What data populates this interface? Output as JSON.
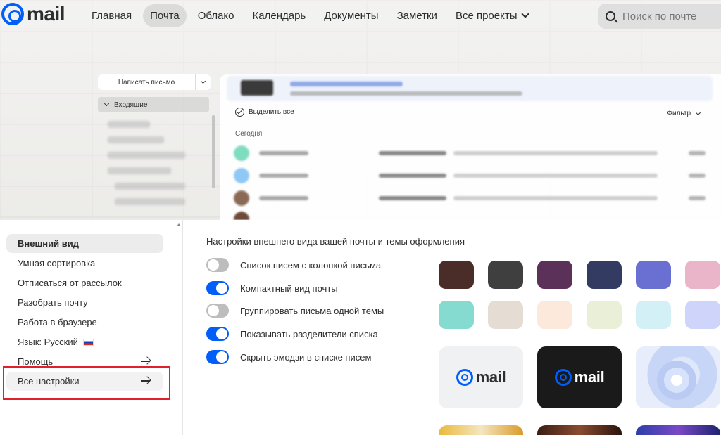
{
  "header": {
    "logo_text": "mail",
    "nav": [
      "Главная",
      "Почта",
      "Облако",
      "Календарь",
      "Документы",
      "Заметки",
      "Все проекты"
    ],
    "active_nav": "Почта",
    "search_placeholder": "Поиск по почте"
  },
  "mail_bg": {
    "compose_label": "Написать письмо",
    "inbox_label": "Входящие",
    "select_all": "Выделить все",
    "filter": "Фильтр",
    "today": "Сегодня"
  },
  "menu": {
    "items": [
      "Внешний вид",
      "Умная сортировка",
      "Отписаться от рассылок",
      "Разобрать почту",
      "Работа в браузере",
      "Язык: Русский",
      "Помощь",
      "Все настройки"
    ]
  },
  "appearance": {
    "title": "Настройки внешнего вида вашей почты и темы оформления",
    "toggles": [
      {
        "label": "Список писем с колонкой письма",
        "on": false
      },
      {
        "label": "Компактный вид почты",
        "on": true
      },
      {
        "label": "Группировать письма одной темы",
        "on": false
      },
      {
        "label": "Показывать разделители списка",
        "on": true
      },
      {
        "label": "Скрыть эмодзи в списке писем",
        "on": true
      }
    ],
    "swatches_row1": [
      "#4a2c28",
      "#3f3f3f",
      "#5b3059",
      "#343b62",
      "#6a6fd2",
      "#eab5c8"
    ],
    "swatches_row2": [
      "#86dbd0",
      "#e5dcd4",
      "#fde8dc",
      "#eaf0d8",
      "#d3f0f6",
      "#cfd4fb"
    ],
    "theme_cards": [
      {
        "style": "light",
        "text": "mail"
      },
      {
        "style": "dark",
        "text": "mail"
      },
      {
        "style": "snow",
        "text": ""
      }
    ],
    "accent": "#005ff9"
  }
}
